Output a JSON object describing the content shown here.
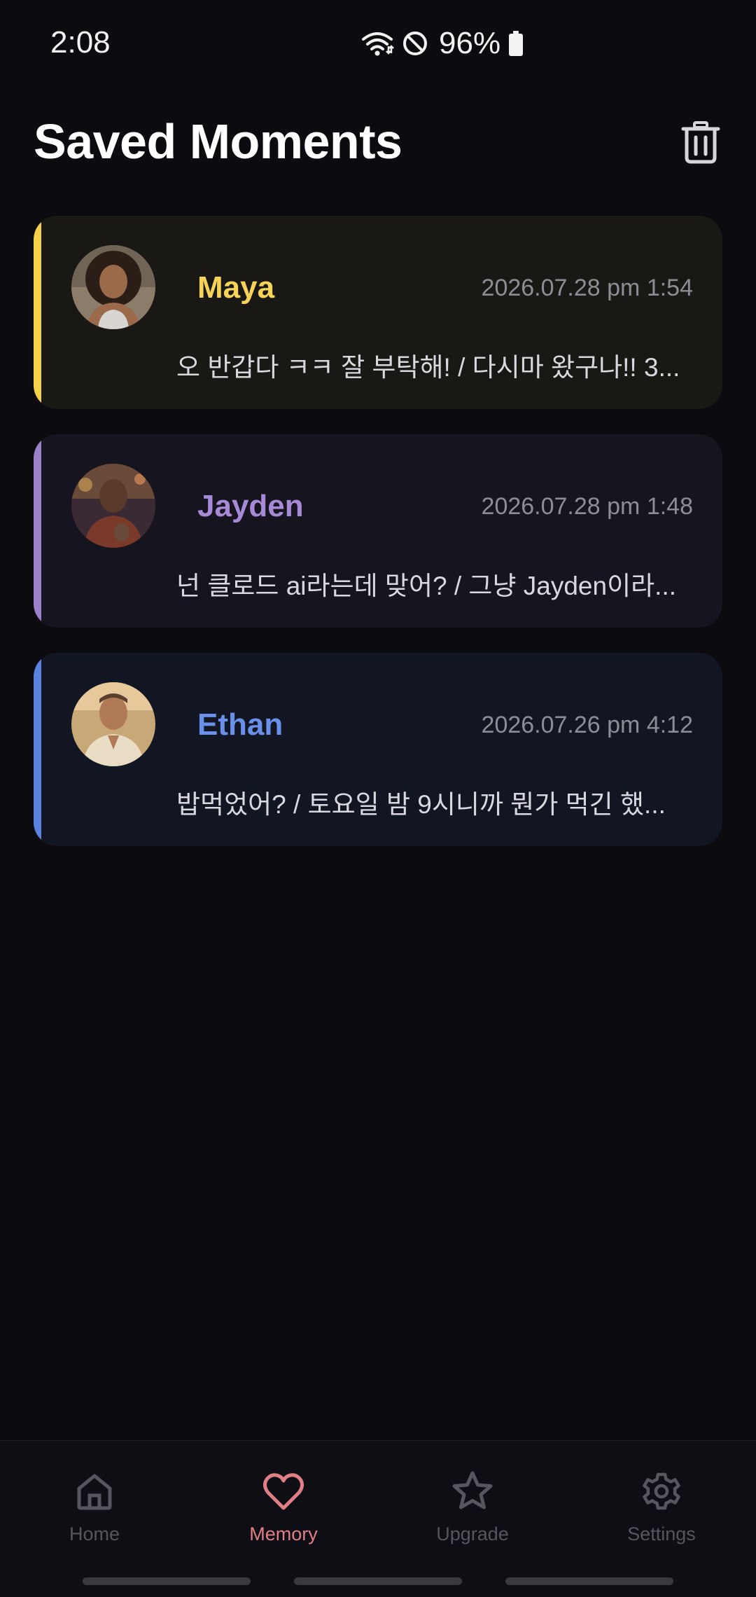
{
  "status_bar": {
    "time": "2:08",
    "battery": "96%"
  },
  "header": {
    "title": "Saved Moments",
    "delete_icon": "trash-icon"
  },
  "moments": [
    {
      "name": "Maya",
      "timestamp": "2026.07.28 pm 1:54",
      "preview": "오 반갑다 ㅋㅋ 잘 부탁해! / 다시마 왔구나!! 3...",
      "accent_color": "#f5d04a",
      "name_color": "#f7d358",
      "card_bg": "#1a1814"
    },
    {
      "name": "Jayden",
      "timestamp": "2026.07.28 pm 1:48",
      "preview": "넌 클로드 ai라는데 맞어? / 그냥 Jayden이라...",
      "accent_color": "#9a7fc9",
      "name_color": "#a68ad6",
      "card_bg": "#16141e"
    },
    {
      "name": "Ethan",
      "timestamp": "2026.07.26 pm 4:12",
      "preview": "밥먹었어? / 토요일 밤 9시니까 뭔가 먹긴 했...",
      "accent_color": "#5b82e0",
      "name_color": "#6a90ea",
      "card_bg": "#121622"
    }
  ],
  "bottom_nav": {
    "items": [
      {
        "label": "Home",
        "icon": "home-icon"
      },
      {
        "label": "Memory",
        "icon": "heart-icon",
        "active": true
      },
      {
        "label": "Upgrade",
        "icon": "star-icon"
      },
      {
        "label": "Settings",
        "icon": "gear-icon"
      }
    ]
  }
}
